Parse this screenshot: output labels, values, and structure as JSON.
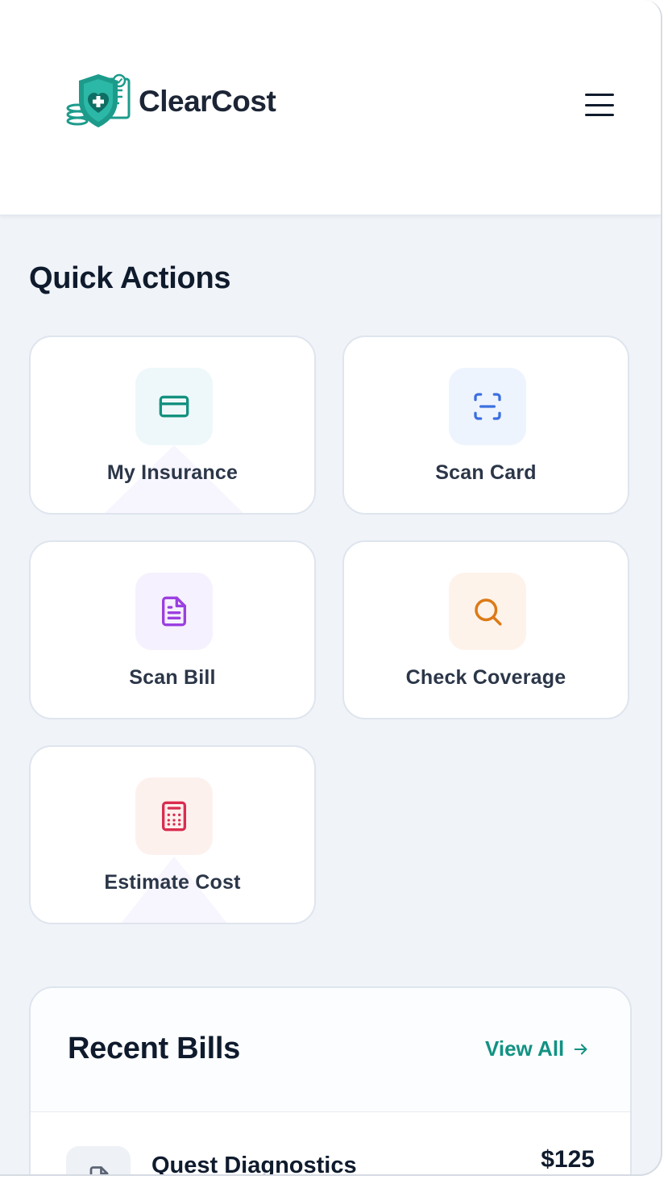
{
  "header": {
    "brand": "ClearCost",
    "menu_icon": "hamburger-menu-icon"
  },
  "quick_actions": {
    "title": "Quick Actions",
    "items": [
      {
        "label": "My Insurance",
        "icon": "credit-card-icon",
        "color": "#14917f",
        "bg": "#eef8fa"
      },
      {
        "label": "Scan Card",
        "icon": "scan-icon",
        "color": "#3b6fe0",
        "bg": "#eef4fd"
      },
      {
        "label": "Scan Bill",
        "icon": "document-icon",
        "color": "#9b3fe0",
        "bg": "#f6f1fe"
      },
      {
        "label": "Check Coverage",
        "icon": "search-icon",
        "color": "#dc7a17",
        "bg": "#fdf3ea"
      },
      {
        "label": "Estimate Cost",
        "icon": "calculator-icon",
        "color": "#d92d4f",
        "bg": "#fdf1ee"
      }
    ]
  },
  "recent_bills": {
    "title": "Recent Bills",
    "view_all": "View All",
    "items": [
      {
        "provider": "Quest Diagnostics",
        "amount": "$125",
        "icon": "file-icon"
      }
    ]
  },
  "colors": {
    "accent": "#129283",
    "background": "#f0f3f8",
    "text": "#0f1b2d"
  }
}
